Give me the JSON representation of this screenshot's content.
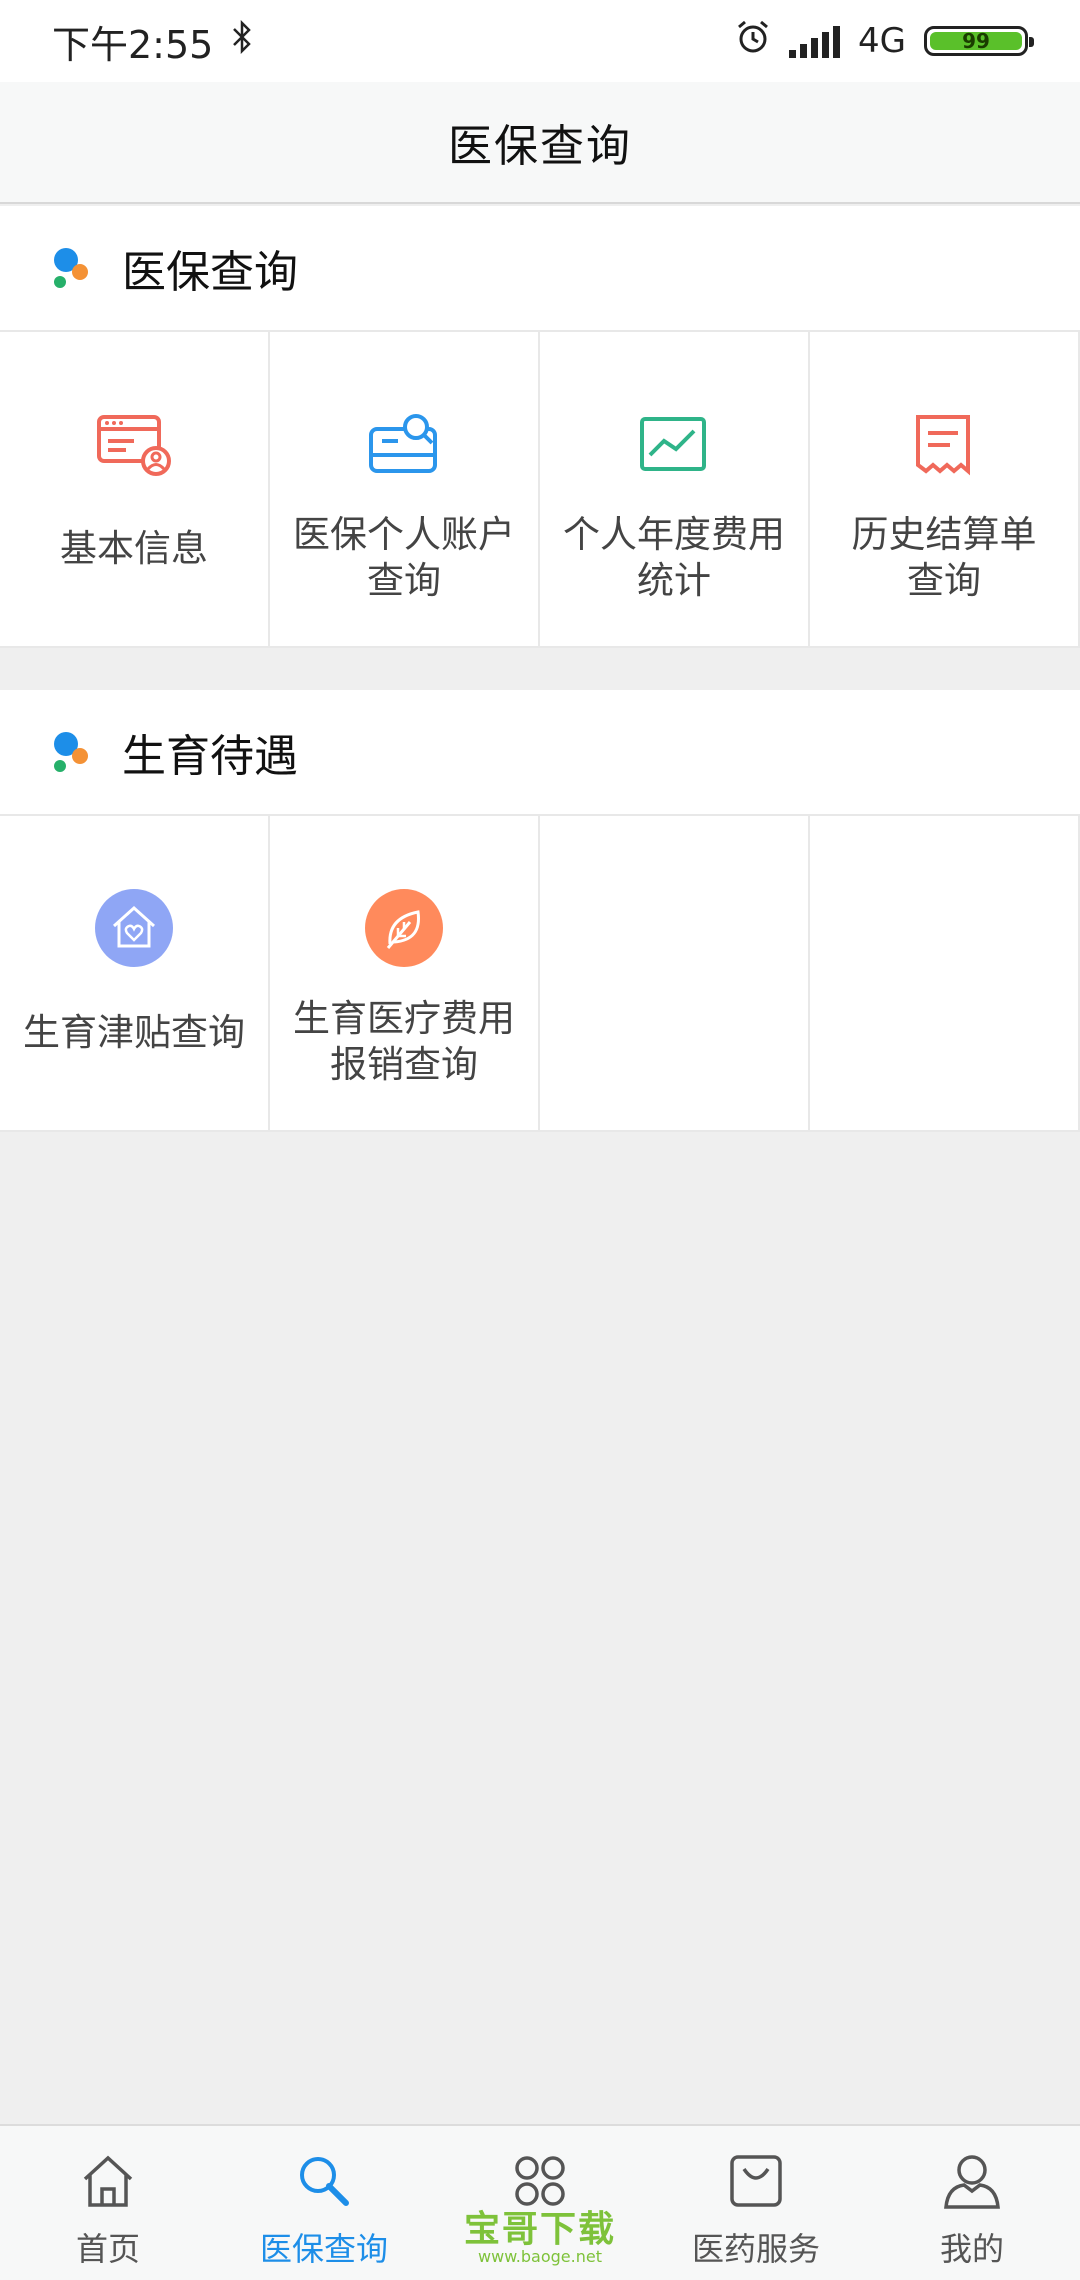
{
  "status_bar": {
    "time": "下午2:55",
    "network": "4G",
    "battery": "99"
  },
  "header": {
    "title": "医保查询"
  },
  "sections": [
    {
      "title": "医保查询",
      "items": [
        {
          "label": "基本信息",
          "icon": "id-card-user-icon"
        },
        {
          "label": "医保个人账户\n查询",
          "icon": "card-search-icon"
        },
        {
          "label": "个人年度费用\n统计",
          "icon": "trend-chart-icon"
        },
        {
          "label": "历史结算单\n查询",
          "icon": "receipt-icon"
        }
      ]
    },
    {
      "title": "生育待遇",
      "items": [
        {
          "label": "生育津贴查询",
          "icon": "house-heart-icon"
        },
        {
          "label": "生育医疗费用\n报销查询",
          "icon": "leaf-icon"
        }
      ]
    }
  ],
  "bottom_nav": {
    "items": [
      {
        "label": "首页",
        "icon": "home-icon"
      },
      {
        "label": "医保查询",
        "icon": "search-icon",
        "active": true
      },
      {
        "label": "",
        "icon": "grid-icon"
      },
      {
        "label": "医药服务",
        "icon": "shopping-bag-icon"
      },
      {
        "label": "我的",
        "icon": "user-icon"
      }
    ]
  },
  "watermark": {
    "main": "宝哥下载",
    "sub": "www.baoge.net"
  },
  "colors": {
    "accent": "#1d8ee8",
    "orange": "#f49236",
    "green": "#26b06a",
    "icon_red": "#f0695a",
    "icon_blue": "#2b96ec",
    "icon_teal": "#2fb489",
    "purple_circle": "#8fa6f5",
    "orange_circle": "#ff8a5c"
  }
}
